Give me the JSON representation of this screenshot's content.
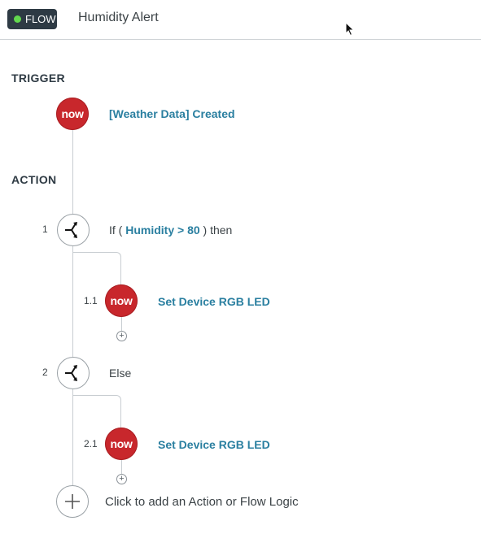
{
  "header": {
    "badge_label": "FLOW",
    "title": "Humidity Alert"
  },
  "trigger": {
    "section_label": "TRIGGER",
    "icon_text": "now",
    "label": "[Weather Data] Created"
  },
  "action": {
    "section_label": "ACTION",
    "steps": [
      {
        "number": "1",
        "icon": "branch-icon",
        "prefix": "If (",
        "condition": "Humidity > 80",
        "suffix": ") then",
        "child": {
          "number": "1.1",
          "icon_text": "now",
          "label": "Set Device RGB LED"
        }
      },
      {
        "number": "2",
        "icon": "branch-icon",
        "label": "Else",
        "child": {
          "number": "2.1",
          "icon_text": "now",
          "label": "Set Device RGB LED"
        }
      }
    ],
    "add_label": "Click to add an Action or Flow Logic"
  },
  "colors": {
    "badge_bg": "#2e3a44",
    "status_dot": "#62d84e",
    "now_red": "#c8272c",
    "link_blue": "#2a7fa0"
  }
}
